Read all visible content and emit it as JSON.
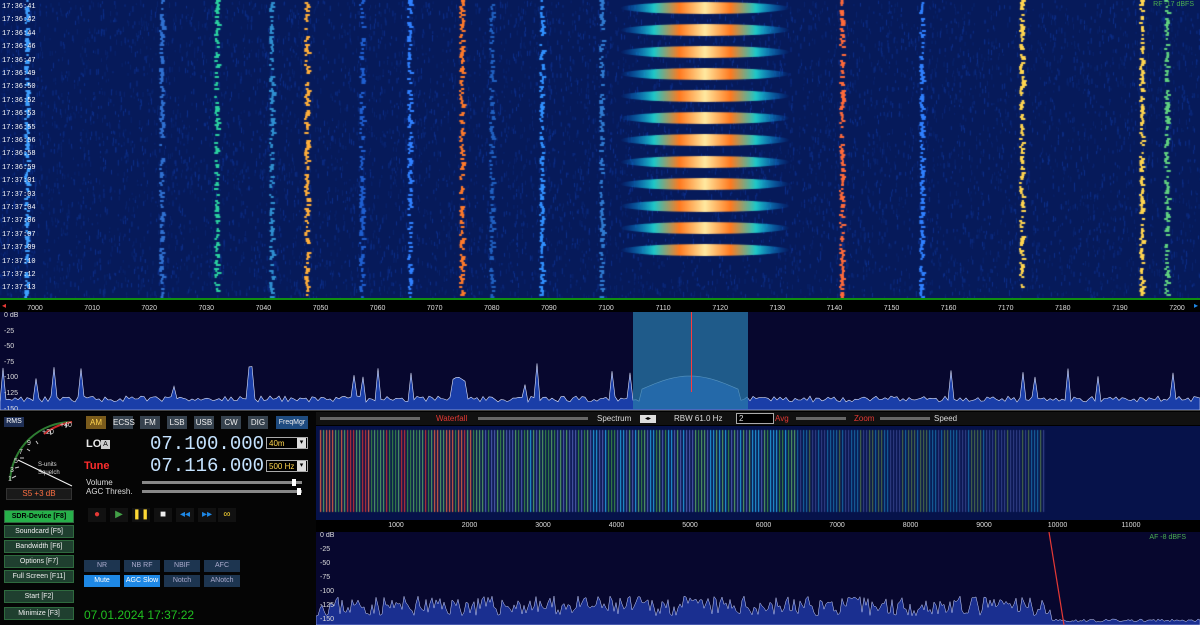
{
  "waterfall_times": [
    "17:36:41",
    "17:36:42",
    "17:36:44",
    "17:36:46",
    "17:36:47",
    "17:36:49",
    "17:36:50",
    "17:36:52",
    "17:36:53",
    "17:36:55",
    "17:36:56",
    "17:36:58",
    "17:36:59",
    "17:37:01",
    "17:37:03",
    "17:37:04",
    "17:37:06",
    "17:37:07",
    "17:37:09",
    "17:37:10",
    "17:37:12",
    "17:37:13"
  ],
  "freq_ticks": [
    "7000",
    "7010",
    "7020",
    "7030",
    "7040",
    "7050",
    "7060",
    "7070",
    "7080",
    "7090",
    "7100",
    "7110",
    "7120",
    "7130",
    "7140",
    "7150",
    "7160",
    "7170",
    "7180",
    "7190",
    "7200"
  ],
  "rf_spectrum": {
    "db_ticks": [
      "0 dB",
      "-25",
      "-50",
      "-75",
      "-100",
      "-125",
      "-150"
    ],
    "level": "RF -17 dBFS"
  },
  "smeter": {
    "rms": "RMS",
    "ticks": [
      "+40",
      "+20",
      "9",
      "7",
      "5",
      "3",
      "1"
    ],
    "label1": "S-units",
    "label2": "Squelch",
    "readout": "S5 +3 dB"
  },
  "side_buttons": [
    {
      "label": "SDR-Device [F8]",
      "active": true
    },
    {
      "label": "Soundcard [F5]",
      "active": false
    },
    {
      "label": "Bandwidth [F6]",
      "active": false
    },
    {
      "label": "Options [F7]",
      "active": false
    },
    {
      "label": "Full Screen [F11]",
      "active": false
    },
    {
      "label": "Start [F2]",
      "active": false
    },
    {
      "label": "Minimize [F3]",
      "active": false
    }
  ],
  "modes": [
    {
      "label": "AM",
      "active": true
    },
    {
      "label": "ECSS",
      "active": false
    },
    {
      "label": "FM",
      "active": false
    },
    {
      "label": "LSB",
      "active": false
    },
    {
      "label": "USB",
      "active": false
    },
    {
      "label": "CW",
      "active": false
    },
    {
      "label": "DIG",
      "active": false
    }
  ],
  "freqmgr": "FreqMgr",
  "lo": {
    "label": "LO",
    "marker": "A",
    "value": "07.100.000",
    "band": "40m"
  },
  "tune": {
    "label": "Tune",
    "value": "07.116.000",
    "bandwidth": "500 Hz"
  },
  "volume_label": "Volume",
  "agc_label": "AGC Thresh.",
  "dsp_buttons_row1": [
    {
      "label": "NR",
      "on": false
    },
    {
      "label": "NB RF",
      "on": false
    },
    {
      "label": "NBIF",
      "on": false
    },
    {
      "label": "AFC",
      "on": false
    }
  ],
  "dsp_buttons_row2": [
    {
      "label": "Mute",
      "on": true
    },
    {
      "label": "AGC Slow",
      "on": true
    },
    {
      "label": "Notch",
      "on": false
    },
    {
      "label": "ANotch",
      "on": false
    }
  ],
  "datetime": "07.01.2024 17:37:22",
  "sub_controls": {
    "waterfall": "Waterfall",
    "spectrum": "Spectrum",
    "rbw": "RBW 61.0 Hz",
    "avg_value": "2",
    "avg": "Avg",
    "zoom": "Zoom",
    "speed": "Speed"
  },
  "audio_ticks": [
    "1000",
    "2000",
    "3000",
    "4000",
    "5000",
    "6000",
    "7000",
    "8000",
    "9000",
    "10000",
    "11000"
  ],
  "af_spectrum": {
    "db_ticks": [
      "0 dB",
      "-25",
      "-50",
      "-75",
      "-100",
      "-125",
      "-150"
    ],
    "level": "AF -8 dBFS"
  },
  "colors": {
    "accent_green": "#27b04a",
    "tune_red": "#ff2d2d",
    "freq_blue": "#c5e3ff",
    "waterfall_bg": "#061a5a"
  }
}
